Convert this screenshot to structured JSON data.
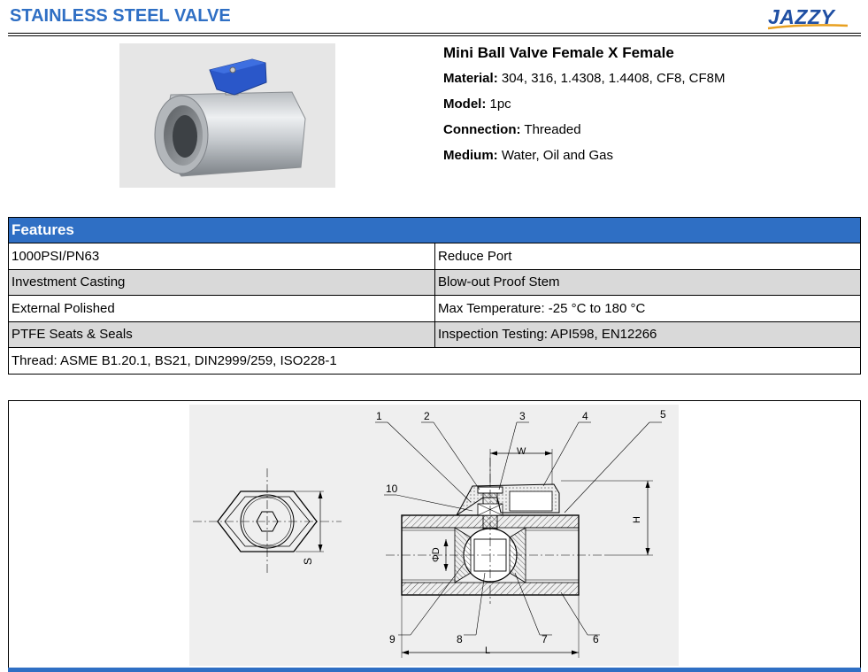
{
  "header": {
    "title": "STAINLESS STEEL VALVE",
    "logo_text": "JAZZY"
  },
  "product": {
    "name": "Mini Ball Valve Female X Female",
    "specs": [
      {
        "label": "Material:",
        "value": "304, 316, 1.4308, 1.4408, CF8, CF8M"
      },
      {
        "label": "Model:",
        "value": "1pc"
      },
      {
        "label": "Connection:",
        "value": "Threaded"
      },
      {
        "label": "Medium:",
        "value": "Water, Oil and Gas"
      }
    ]
  },
  "features": {
    "heading": "Features",
    "rows": [
      [
        "1000PSI/PN63",
        "Reduce Port"
      ],
      [
        "Investment Casting",
        "Blow-out Proof Stem"
      ],
      [
        "External Polished",
        "Max Temperature: -25 °C to 180 °C"
      ],
      [
        "PTFE Seats & Seals",
        "Inspection Testing: API598, EN12266"
      ]
    ],
    "full_row": "Thread: ASME B1.20.1, BS21, DIN2999/259, ISO228-1"
  },
  "drawing": {
    "callouts_top": [
      "1",
      "2",
      "3",
      "4",
      "5"
    ],
    "callout_side": "10",
    "callouts_bottom": [
      "9",
      "8",
      "7",
      "6"
    ],
    "dim_w": "W",
    "dim_h": "H",
    "dim_d": "ΦD",
    "dim_l": "L",
    "dim_s": "S"
  },
  "colors": {
    "accent": "#2f6fc4",
    "logo": "#1f4fa3",
    "row_shade": "#d9d9d9",
    "handle_blue": "#2a57c9"
  }
}
